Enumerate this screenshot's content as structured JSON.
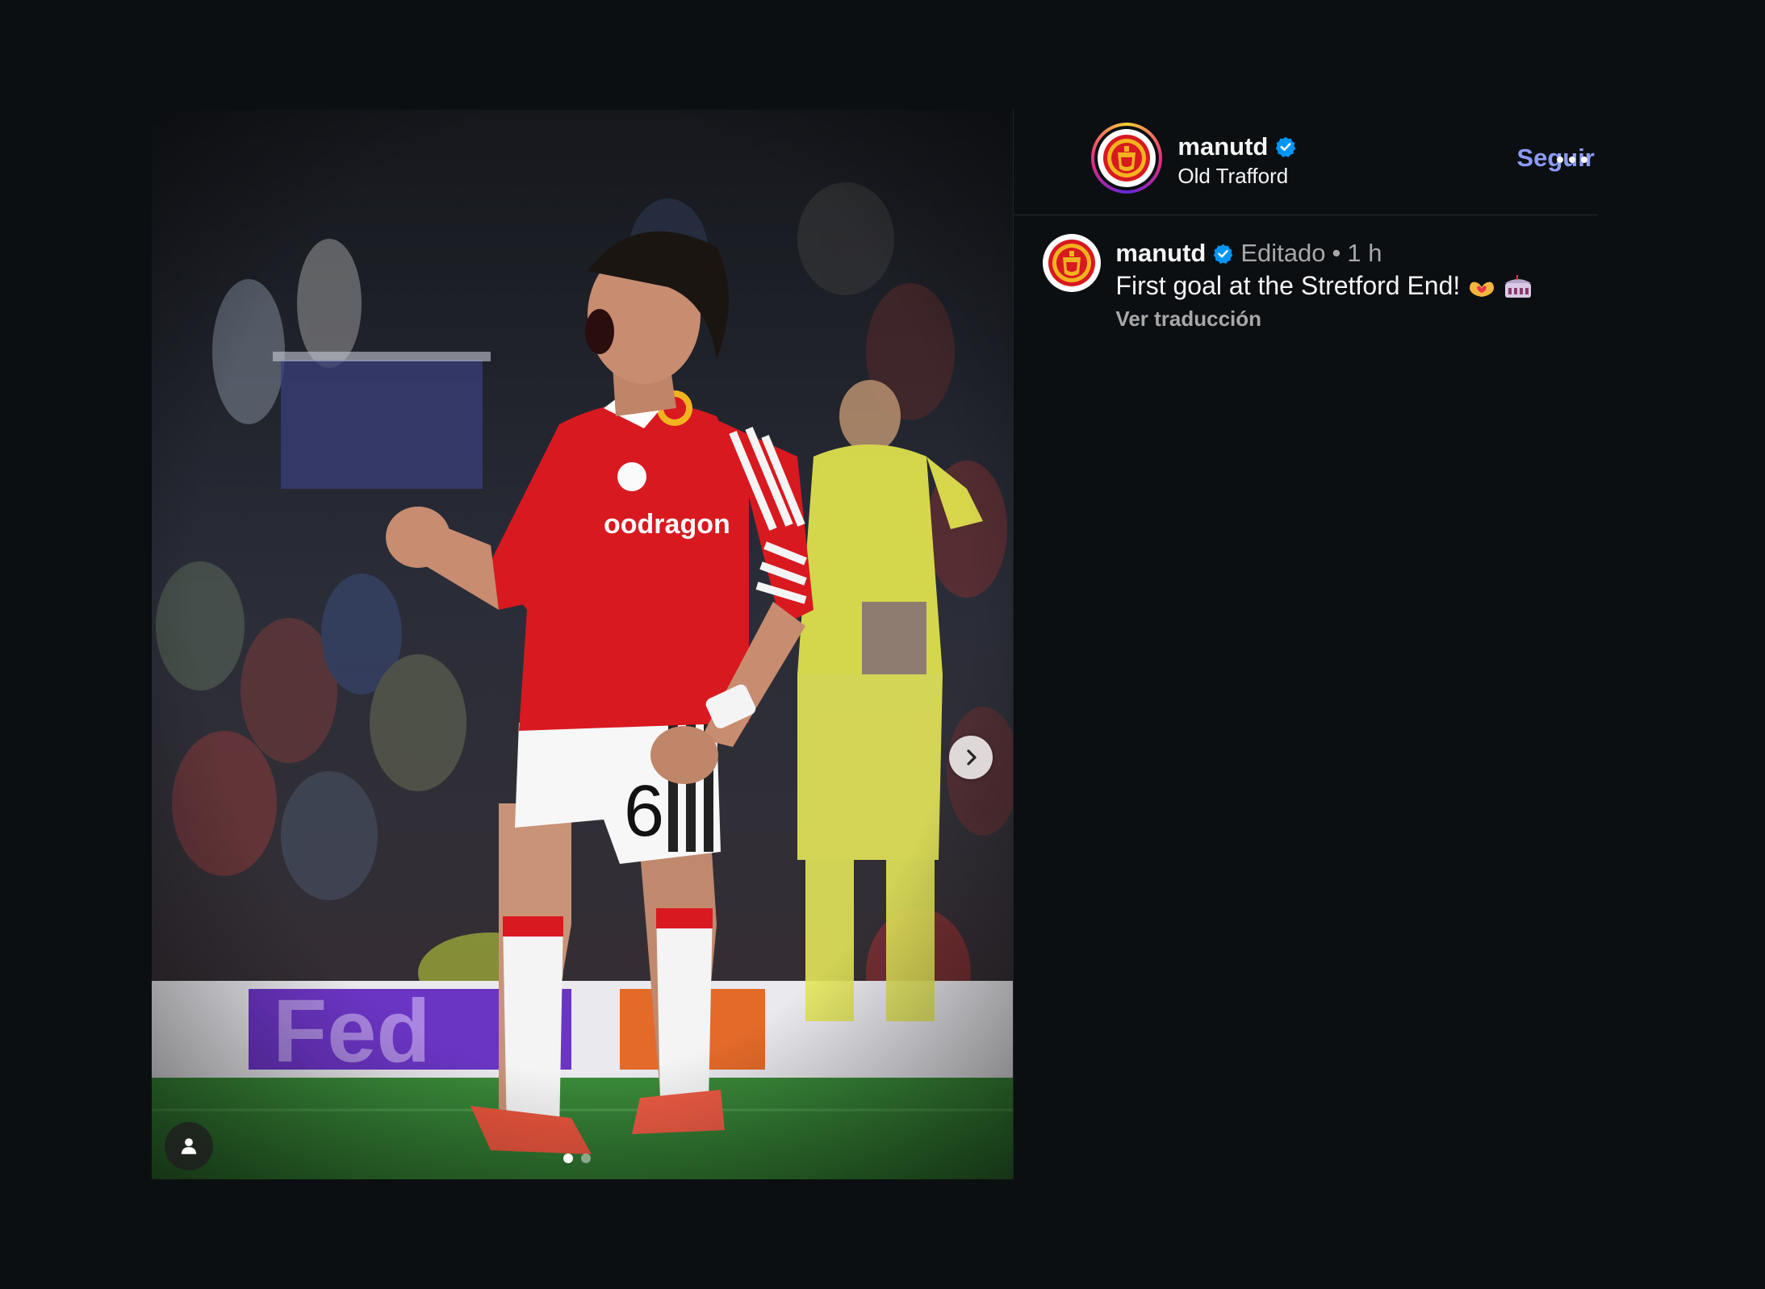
{
  "colors": {
    "background": "#0b0f12",
    "follow_link": "#8c9bf5",
    "verified": "#0095f6",
    "secondary_text": "#a8a8a8",
    "kit_red": "#d81920"
  },
  "post": {
    "media": {
      "next_icon": "chevron-right-icon",
      "tag_icon": "user-tag-icon",
      "carousel": {
        "count": 2,
        "active_index": 0
      }
    },
    "header": {
      "username": "manutd",
      "verified_icon": "verified-badge-icon",
      "location": "Old Trafford",
      "follow_label": "Seguir",
      "more_icon": "more-horizontal-icon"
    },
    "caption": {
      "username": "manutd",
      "edited_label": "Editado",
      "separator": "•",
      "time": "1 h",
      "text": "First goal at the Stretford End!",
      "emojis": [
        "heart-hands-emoji",
        "stadium-emoji"
      ],
      "translate_label": "Ver traducción"
    }
  }
}
